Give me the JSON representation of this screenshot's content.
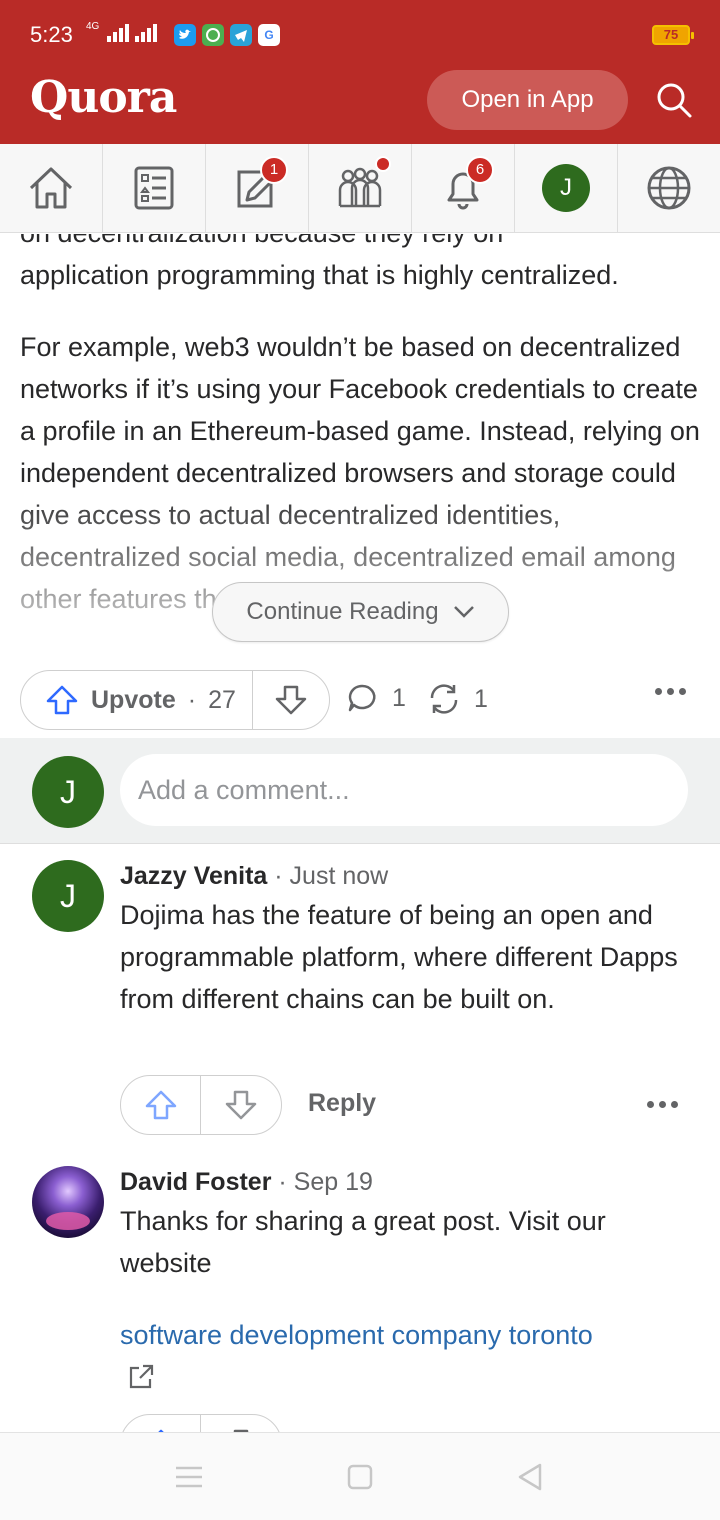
{
  "status_bar": {
    "time": "5:23",
    "network_label": "4G",
    "battery": "75"
  },
  "header": {
    "logo": "Quora",
    "open_app_label": "Open in App"
  },
  "nav_tabs": {
    "write_badge": "1",
    "notifications_badge": "6",
    "profile_initial": "J"
  },
  "answer": {
    "partial_line": "on decentralization because they rely on",
    "paragraph1_end": "application programming that is highly centralized.",
    "paragraph2": "For example, web3 wouldn’t be based on decentralized networks if it’s using your Facebook credentials to create a profile in an Ethereum-based game. Instead, relying on independent decentralized browsers and storage could give access to actual decentralized identities, decentralized social media, decentralized email among other features that wouldn’t requi",
    "continue_label": "Continue Reading"
  },
  "actions": {
    "upvote_label": "Upvote",
    "upvote_separator": "·",
    "upvote_count": "27",
    "comment_count": "1",
    "share_count": "1"
  },
  "add_comment": {
    "avatar_initial": "J",
    "placeholder": "Add a comment..."
  },
  "comments": [
    {
      "avatar_initial": "J",
      "author": "Jazzy Venita",
      "time": "· Just now",
      "text": "Dojima has the feature of being an open and programmable platform, where different Dapps from different chains can be built on.",
      "reply_label": "Reply"
    },
    {
      "author": "David Foster",
      "time": "· Sep 19",
      "text": "Thanks for sharing a great post. Visit our website",
      "link_text": "software development company toronto"
    }
  ],
  "colors": {
    "brand": "#b92b27",
    "link": "#2a6aad",
    "avatar_green": "#2e6b1e",
    "badge_red": "#cb2b25"
  }
}
